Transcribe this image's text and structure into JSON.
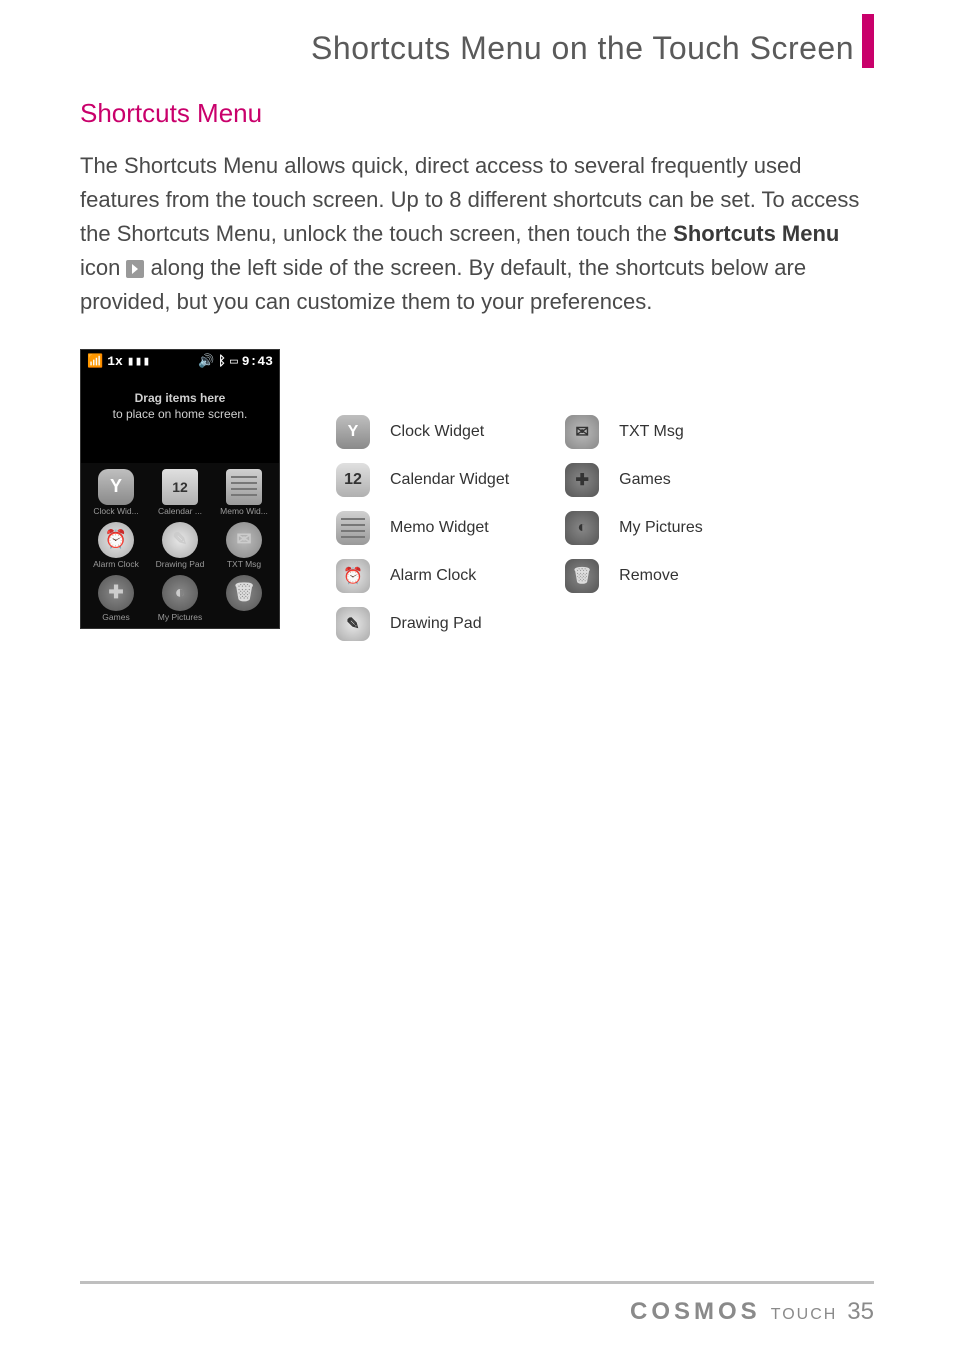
{
  "header": {
    "title": "Shortcuts Menu on the Touch Screen"
  },
  "section": {
    "heading": "Shortcuts Menu",
    "para_before_strong": "The Shortcuts Menu allows quick, direct access to several frequently used features from the touch screen. Up to 8 different shortcuts can be set. To access the Shortcuts Menu, unlock the touch screen, then touch the ",
    "strong": "Shortcuts Menu",
    "para_mid": " icon ",
    "para_after_icon": " along the left side of the screen. By default, the shortcuts below are provided, but you can customize them to your preferences."
  },
  "phone": {
    "status": {
      "signal": "1x",
      "time": "9:43"
    },
    "drag_line1": "Drag items here",
    "drag_line2": "to place on home screen.",
    "grid": [
      {
        "label": "Clock Wid...",
        "icon": "clock",
        "glyph": "Y"
      },
      {
        "label": "Calendar ...",
        "icon": "cal",
        "glyph": "12"
      },
      {
        "label": "Memo Wid...",
        "icon": "memo",
        "glyph": ""
      },
      {
        "label": "Alarm Clock",
        "icon": "alarm",
        "glyph": "⏰"
      },
      {
        "label": "Drawing Pad",
        "icon": "draw",
        "glyph": "✎"
      },
      {
        "label": "TXT Msg",
        "icon": "txt",
        "glyph": "✉"
      },
      {
        "label": "Games",
        "icon": "game",
        "glyph": "✚"
      },
      {
        "label": "My Pictures",
        "icon": "pic",
        "glyph": "◐"
      },
      {
        "label": "",
        "icon": "rem",
        "glyph": "🗑"
      }
    ]
  },
  "legend": {
    "col1": [
      {
        "label": "Clock Widget",
        "icon": "clock",
        "glyph": "Y"
      },
      {
        "label": "Calendar Widget",
        "icon": "cal",
        "glyph": "12"
      },
      {
        "label": "Memo Widget",
        "icon": "memo",
        "glyph": ""
      },
      {
        "label": "Alarm Clock",
        "icon": "alarm",
        "glyph": "⏰"
      },
      {
        "label": "Drawing Pad",
        "icon": "draw",
        "glyph": "✎"
      }
    ],
    "col2": [
      {
        "label": "TXT Msg",
        "icon": "txt",
        "glyph": "✉"
      },
      {
        "label": "Games",
        "icon": "game",
        "glyph": "✚"
      },
      {
        "label": "My Pictures",
        "icon": "pic",
        "glyph": "◐"
      },
      {
        "label": "Remove",
        "icon": "rem",
        "glyph": "🗑"
      }
    ]
  },
  "footer": {
    "brand": "COSMOS",
    "sub": "TOUCH",
    "page": "35"
  }
}
